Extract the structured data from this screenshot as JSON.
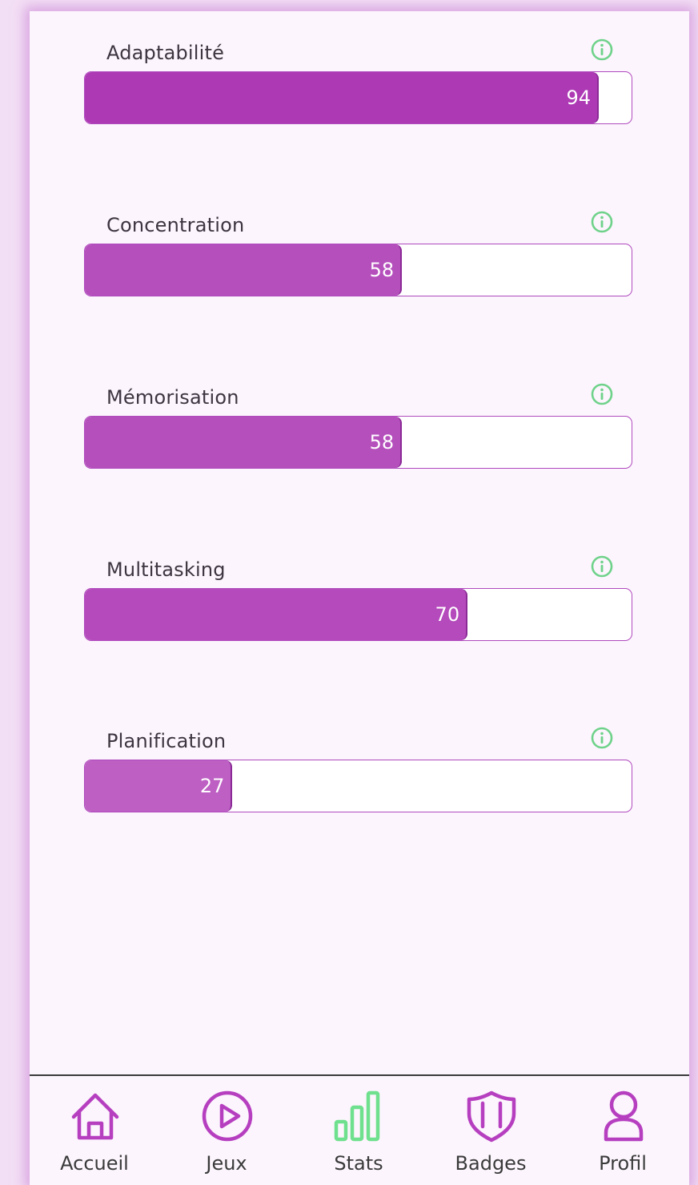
{
  "stats": [
    {
      "label": "Adaptabilité",
      "value": 94,
      "display": "94",
      "max": 100,
      "fill_color": "#ad39b4"
    },
    {
      "label": "Concentration",
      "value": 58,
      "display": "58",
      "max": 100,
      "fill_color": "#b54fbc"
    },
    {
      "label": "Mémorisation",
      "value": 58,
      "display": "58",
      "max": 100,
      "fill_color": "#b54fbc"
    },
    {
      "label": "Multitasking",
      "value": 70,
      "display": "70",
      "max": 100,
      "fill_color": "#b44abb"
    },
    {
      "label": "Planification",
      "value": 27,
      "display": "27",
      "max": 100,
      "fill_color": "#bd5fc3"
    }
  ],
  "info_icon": {
    "name": "info-icon",
    "color": "#6fd28a"
  },
  "nav": {
    "items": [
      {
        "label": "Accueil",
        "icon": "home-icon",
        "active": false
      },
      {
        "label": "Jeux",
        "icon": "play-icon",
        "active": false
      },
      {
        "label": "Stats",
        "icon": "bar-chart-icon",
        "active": true
      },
      {
        "label": "Badges",
        "icon": "shield-icon",
        "active": false
      },
      {
        "label": "Profil",
        "icon": "user-icon",
        "active": false
      }
    ],
    "icon_color": "#b63fc0",
    "active_color": "#6fe08e"
  }
}
